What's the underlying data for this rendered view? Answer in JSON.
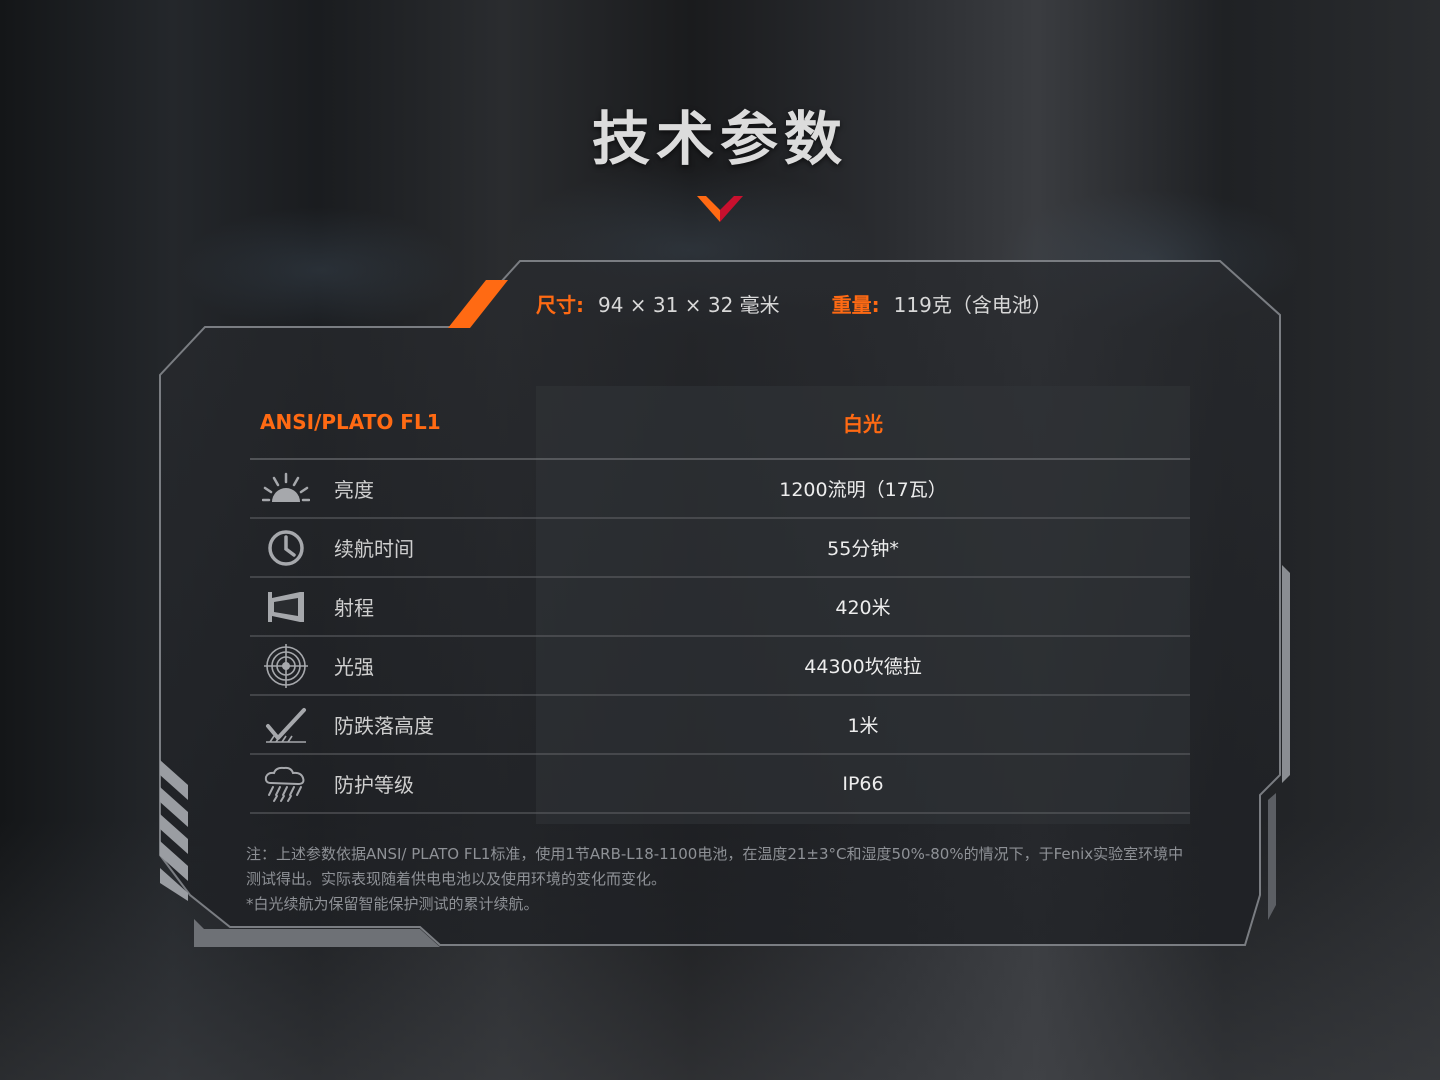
{
  "page": {
    "title": "技术参数"
  },
  "meta": {
    "size_label": "尺寸:",
    "size_value": "94 × 31 × 32 毫米",
    "weight_label": "重量:",
    "weight_value": "119克（含电池）"
  },
  "table": {
    "header": {
      "standard": "ANSI/PLATO FL1",
      "mode": "白光"
    },
    "rows": [
      {
        "icon": "brightness-icon",
        "label": "亮度",
        "value": "1200流明（17瓦）"
      },
      {
        "icon": "clock-icon",
        "label": "续航时间",
        "value": "55分钟*"
      },
      {
        "icon": "beam-distance-icon",
        "label": "射程",
        "value": "420米"
      },
      {
        "icon": "target-icon",
        "label": "光强",
        "value": "44300坎德拉"
      },
      {
        "icon": "impact-resistance-icon",
        "label": "防跌落高度",
        "value": "1米"
      },
      {
        "icon": "rain-cloud-icon",
        "label": "防护等级",
        "value": "IP66"
      }
    ]
  },
  "notes": {
    "line1": "注：上述参数依据ANSI/ PLATO FL1标准，使用1节ARB-L18-1100电池，在温度21±3°C和湿度50%-80%的情况下，于Fenix实验室环境中",
    "line2": "测试得出。实际表现随着供电电池以及使用环境的变化而变化。",
    "line3": "*白光续航为保留智能保护测试的累计续航。"
  },
  "colors": {
    "accent": "#ff6a13",
    "accent_dark": "#c8102e"
  }
}
